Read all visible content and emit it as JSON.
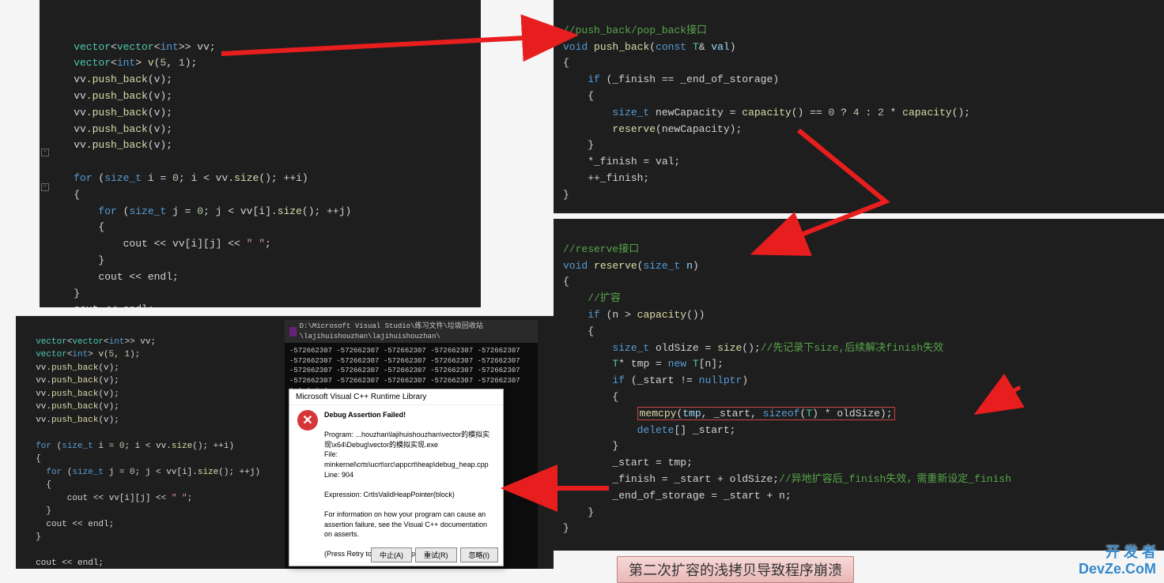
{
  "panel1_lines": [
    "",
    "    vector<vector<int>> vv;",
    "    vector<int> v(5, 1);",
    "    vv.push_back(v);",
    "    vv.push_back(v);",
    "    vv.push_back(v);",
    "    vv.push_back(v);",
    "    vv.push_back(v);",
    "",
    "    for (size_t i = 0; i < vv.size(); ++i)",
    "    {",
    "        for (size_t j = 0; j < vv[i].size(); ++j)",
    "        {",
    "            cout << vv[i][j] << \" \";",
    "        }",
    "        cout << endl;",
    "    }",
    "    cout << endl;"
  ],
  "panel2_lines": [
    "//push_back/pop_back接口",
    "void push_back(const T& val)",
    "{",
    "    if (_finish == _end_of_storage)",
    "    {",
    "        size_t newCapacity = capacity() == 0 ? 4 : 2 * capacity();",
    "        reserve(newCapacity);",
    "    }",
    "    *_finish = val;",
    "    ++_finish;",
    "}"
  ],
  "panel3_lines": [
    "//reserve接口",
    "void reserve(size_t n)",
    "{",
    "    //扩容",
    "    if (n > capacity())",
    "    {",
    "        size_t oldSize = size();//先记录下size,后续解决finish失效",
    "        T* tmp = new T[n];",
    "        if (_start != nullptr)",
    "        {",
    "            memcpy(tmp, _start, sizeof(T) * oldSize);",
    "            delete[] _start;",
    "        }",
    "        _start = tmp;",
    "        _finish = _start + oldSize;//异地扩容后_finish失效，需重新设定_finish",
    "        _end_of_storage = _start + n;",
    "    }",
    "}"
  ],
  "panel4_lines": [
    "  vector<vector<int>> vv;",
    "  vector<int> v(5, 1);",
    "  vv.push_back(v);",
    "  vv.push_back(v);",
    "  vv.push_back(v);",
    "  vv.push_back(v);",
    "  vv.push_back(v);",
    "",
    "  for (size_t i = 0; i < vv.size(); ++i)",
    "  {",
    "    for (size_t j = 0; j < vv[i].size(); ++j)",
    "    {",
    "        cout << vv[i][j] << \" \";",
    "    }",
    "    cout << endl;",
    "  }",
    "",
    "  cout << endl;"
  ],
  "console": {
    "title_path": "D:\\Microsoft Visual Studio\\练习文件\\垃圾回收站\\lajihuishouzhan\\lajihuishouzhan\\",
    "output": "-572662307 -572662307 -572662307 -572662307 -572662307\n-572662307 -572662307 -572662307 -572662307 -572662307\n-572662307 -572662307 -572662307 -572662307 -572662307\n-572662307 -572662307 -572662307 -572662307 -572662307\n1 1 1 1 1"
  },
  "dialog": {
    "title": "Microsoft Visual C++ Runtime Library",
    "heading": "Debug Assertion Failed!",
    "program": "Program: ...houzhan\\lajihuishouzhan\\vector的模拟实现\\x64\\Debug\\vector的模拟实现.exe",
    "file": "File: minkernel\\crts\\ucrt\\src\\appcrt\\heap\\debug_heap.cpp",
    "line": "Line: 904",
    "expression": "Expression: CrtIsValidHeapPointer(block)",
    "info": "For information on how your program can cause an assertion failure, see the Visual C++ documentation on asserts.",
    "retry": "(Press Retry to debug the application)",
    "btn_abort": "中止(A)",
    "btn_retry": "重试(R)",
    "btn_ignore": "忽略(I)"
  },
  "caption": "第二次扩容的浅拷贝导致程序崩溃",
  "watermark_cn": "开 发 者",
  "watermark_en": "DevZe.CoM"
}
